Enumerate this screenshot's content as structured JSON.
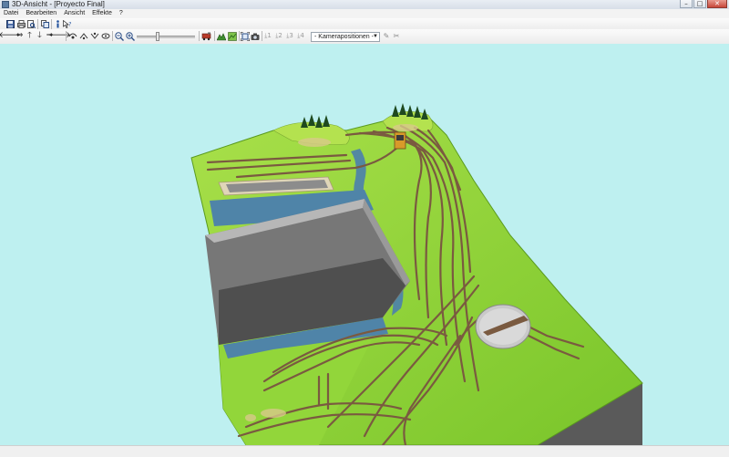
{
  "window": {
    "title": "3D-Ansicht - [Proyecto Final]"
  },
  "menu": [
    "Datei",
    "Bearbeiten",
    "Ansicht",
    "Effekte",
    "?"
  ],
  "toolbar": {
    "camera_dropdown": "- Kamerapositionen -",
    "zoom_slider_level": 0.35
  },
  "scene": {
    "background": "#bef0f0",
    "terrain_color": "#8ad331",
    "water_color": "#4f84a8",
    "pit_color": "#707070",
    "rail_color": "#7a5a40"
  }
}
